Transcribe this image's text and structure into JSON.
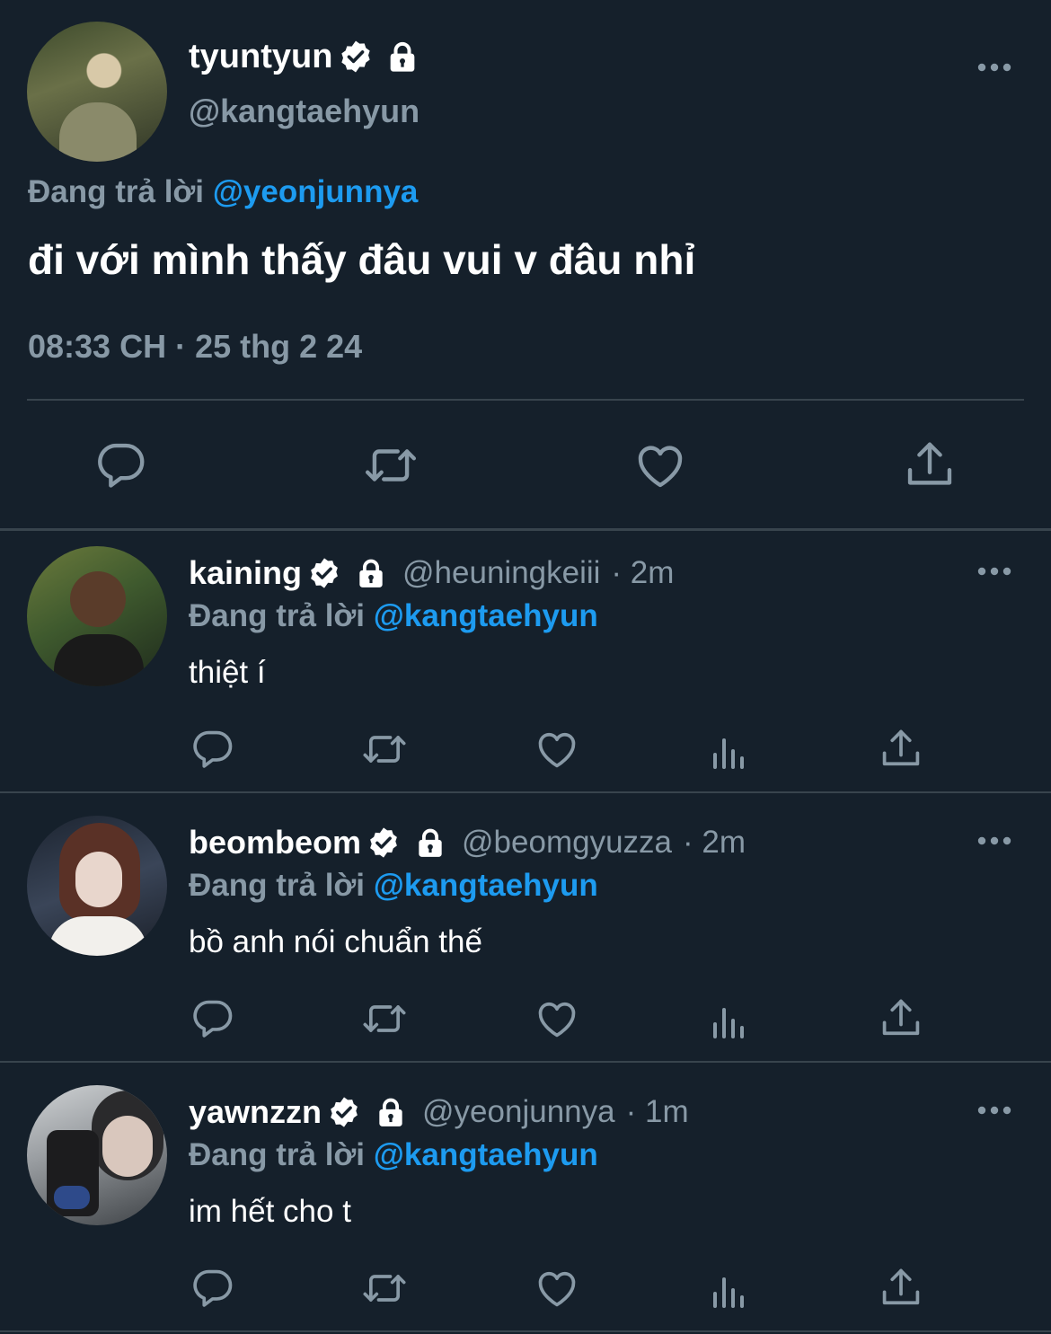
{
  "colors": {
    "background": "#15202b",
    "text": "#ffffff",
    "muted": "#8899a6",
    "link": "#1d9bf0",
    "divider": "#38444d"
  },
  "main_tweet": {
    "display_name": "tyuntyun",
    "handle": "@kangtaehyun",
    "replying_prefix": "Đang trả lời",
    "replying_to": "@yeonjunnya",
    "text": "đi với mình thấy đâu vui v đâu nhỉ",
    "timestamp": "08:33 CH · 25 thg 2 24",
    "icons": [
      "verified-icon",
      "lock-icon",
      "more-icon",
      "reply-icon",
      "retweet-icon",
      "like-icon",
      "share-icon"
    ]
  },
  "replies": [
    {
      "display_name": "kaining",
      "handle": "@heuningkeiii",
      "time": "· 2m",
      "replying_prefix": "Đang trả lời",
      "replying_to": "@kangtaehyun",
      "text": "thiệt í"
    },
    {
      "display_name": "beombeom",
      "handle": "@beomgyuzza",
      "time": "· 2m",
      "replying_prefix": "Đang trả lời",
      "replying_to": "@kangtaehyun",
      "text": "bồ anh nói chuẩn thế"
    },
    {
      "display_name": "yawnzzn",
      "handle": "@yeonjunnya",
      "time": "· 1m",
      "replying_prefix": "Đang trả lời",
      "replying_to": "@kangtaehyun",
      "text": "im hết cho t"
    }
  ],
  "reply_icons": [
    "reply-icon",
    "retweet-icon",
    "like-icon",
    "views-icon",
    "share-icon"
  ]
}
